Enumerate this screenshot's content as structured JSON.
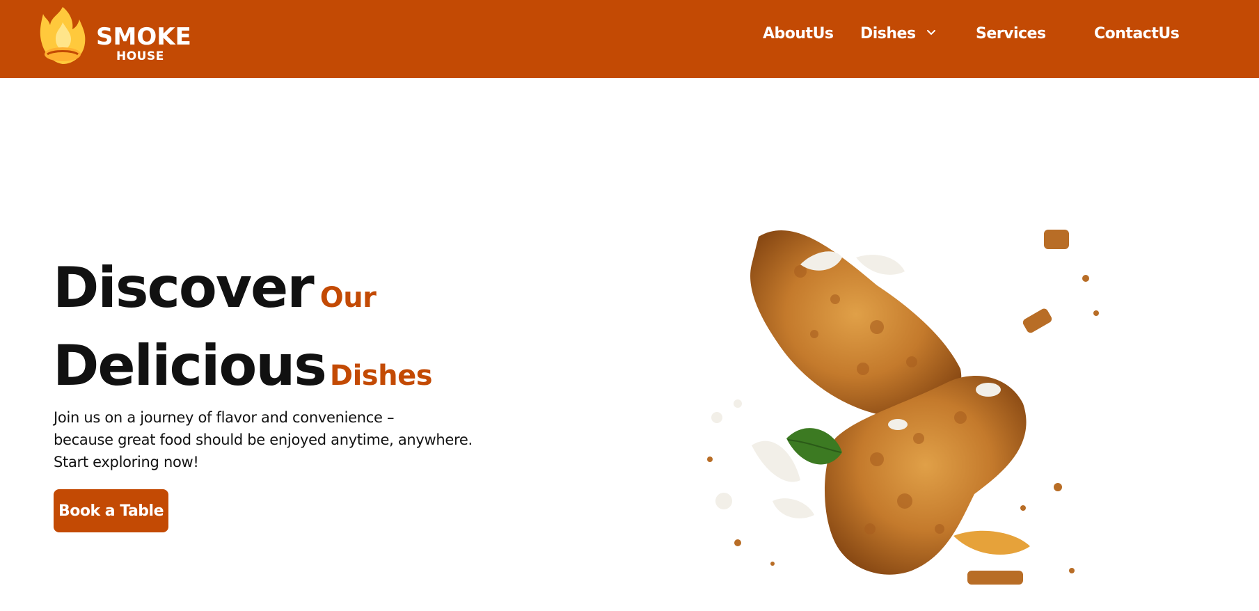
{
  "brand": {
    "name": "SMOKE",
    "sub": "HOUSE",
    "colors": {
      "primary": "#c34a04",
      "flame": "#ffc93c",
      "white": "#ffffff"
    }
  },
  "nav": {
    "items": [
      {
        "label": "AboutUs"
      },
      {
        "label": "Dishes",
        "icon": "chevron-down-icon"
      },
      {
        "label": "Services"
      },
      {
        "label": "ContactUs"
      }
    ]
  },
  "hero": {
    "title_word1": "Discover",
    "title_accent1": "Our",
    "title_word2": "Delicious",
    "title_accent2": "Dishes",
    "desc_lines": [
      "Join us on a journey of flavor and convenience –",
      "because great food should be enjoyed anytime, anywhere.",
      "Start exploring now!"
    ],
    "cta_label": "Book a Table",
    "image": "fried-chicken-image"
  }
}
